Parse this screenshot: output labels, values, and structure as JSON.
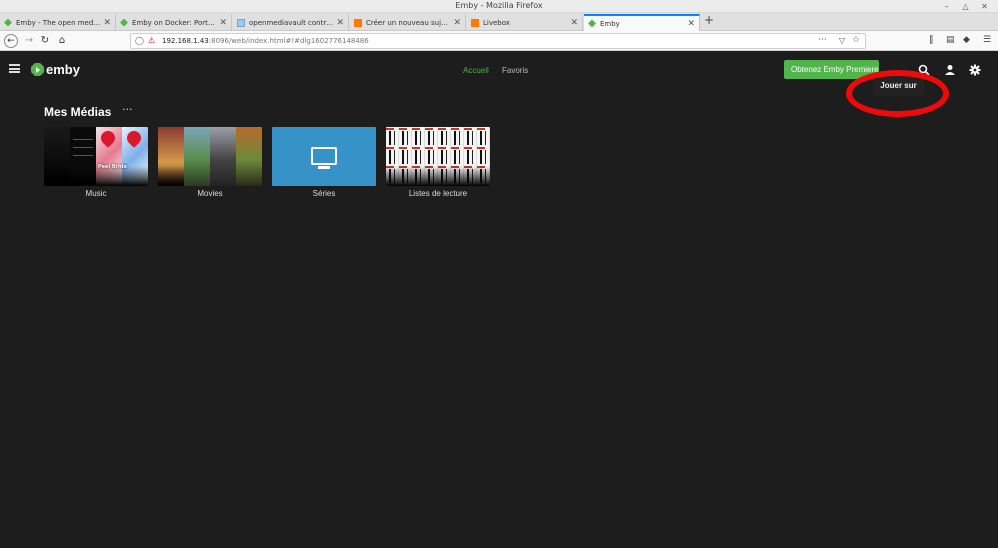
{
  "window": {
    "title": "Emby - Mozilla Firefox"
  },
  "tabs": [
    {
      "label": "Emby - The open media sol",
      "icon": "emby-icon"
    },
    {
      "label": "Emby on Docker: Port for D",
      "icon": "emby-icon"
    },
    {
      "label": "openmediavault control pa",
      "icon": "omv-icon"
    },
    {
      "label": "Créer un nouveau sujet - C",
      "icon": "orange-icon"
    },
    {
      "label": "Livebox",
      "icon": "orange-icon"
    },
    {
      "label": "Emby",
      "icon": "emby-icon",
      "active": true
    }
  ],
  "urlbar": {
    "host": "192.168.1.43",
    "rest": ":8096/web/index.html#!#dlg1602776148486"
  },
  "header": {
    "logo_text": "emby",
    "nav_home": "Accueil",
    "nav_favorites": "Favoris",
    "premiere_button": "Obtenez Emby Premiere",
    "tooltip": "Jouer sur"
  },
  "section": {
    "title": "Mes Médias",
    "more": "···"
  },
  "libraries": [
    {
      "label": "Music"
    },
    {
      "label": "Movies"
    },
    {
      "label": "Séries"
    },
    {
      "label": "Listes de lecture"
    }
  ],
  "music_card_text": "Peel Bride",
  "colors": {
    "accent": "#52b54b",
    "series_tile": "#3792c8",
    "annotation": "#ee0a0a",
    "background": "#1d1d1d"
  }
}
